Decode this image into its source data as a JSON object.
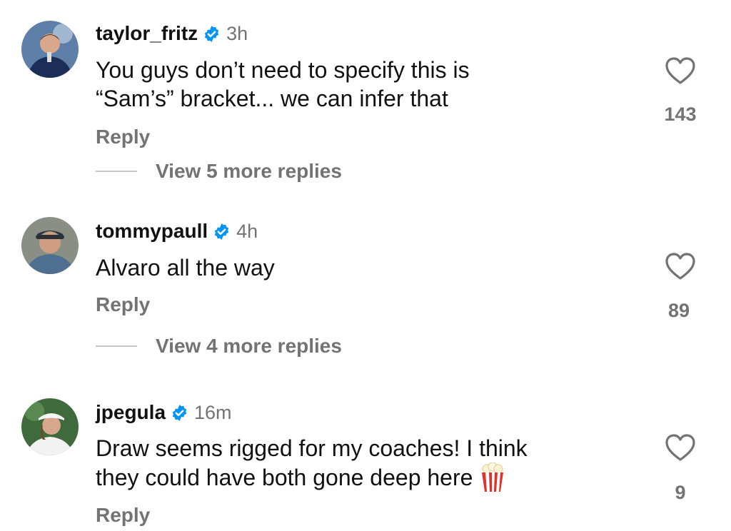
{
  "comments": [
    {
      "username": "taylor_fritz",
      "time": "3h",
      "text_lines": [
        "You guys don’t need to specify this is",
        "“Sam’s” bracket... we can infer that"
      ],
      "reply_label": "Reply",
      "view_replies": "View 5 more replies",
      "likes": "143",
      "avatar_icon": "avatar-photo"
    },
    {
      "username": "tommypaull",
      "time": "4h",
      "text_lines": [
        "Alvaro all the way"
      ],
      "reply_label": "Reply",
      "view_replies": "View 4 more replies",
      "likes": "89",
      "avatar_icon": "avatar-photo"
    },
    {
      "username": "jpegula",
      "time": "16m",
      "text_lines": [
        "Draw seems rigged for my coaches! I think",
        "they could have both gone deep here"
      ],
      "reply_label": "Reply",
      "likes": "9",
      "emoji": "popcorn",
      "avatar_icon": "avatar-photo"
    }
  ],
  "colors": {
    "verified": "#0095f6",
    "secondary_text": "#737373",
    "primary_text": "#111111"
  }
}
